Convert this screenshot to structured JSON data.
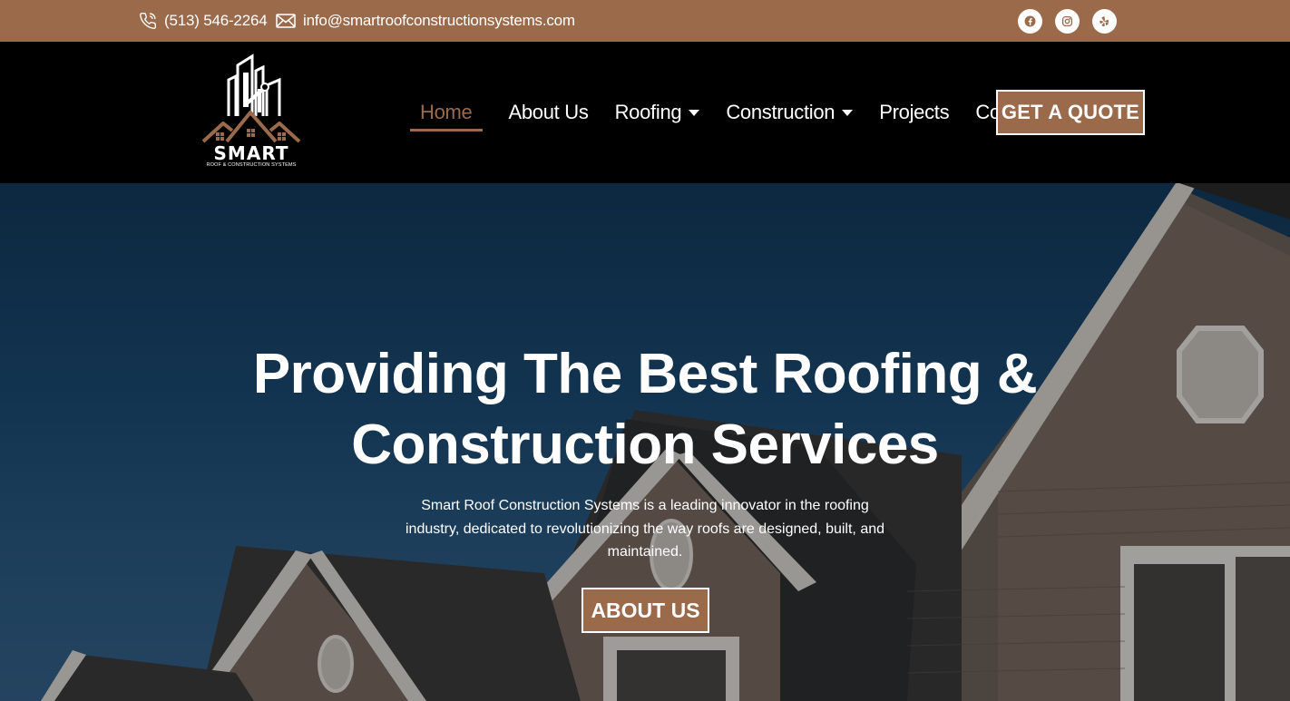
{
  "topbar": {
    "phone": "(513) 546-2264",
    "email": "info@smartroofconstructionsystems.com",
    "socials": [
      {
        "name": "facebook",
        "icon": "facebook-icon"
      },
      {
        "name": "instagram",
        "icon": "instagram-icon"
      },
      {
        "name": "yelp",
        "icon": "yelp-icon"
      }
    ]
  },
  "logo": {
    "brand": "SMART",
    "tagline": "ROOF & CONSTRUCTION SYSTEMS"
  },
  "nav": {
    "items": [
      {
        "label": "Home",
        "active": true,
        "dropdown": false
      },
      {
        "label": "About Us",
        "active": false,
        "dropdown": false
      },
      {
        "label": "Roofing",
        "active": false,
        "dropdown": true
      },
      {
        "label": "Construction",
        "active": false,
        "dropdown": true
      },
      {
        "label": "Projects",
        "active": false,
        "dropdown": false
      },
      {
        "label": "Contact Us",
        "active": false,
        "dropdown": false
      }
    ],
    "cta": "GET A QUOTE"
  },
  "hero": {
    "title_line1": "Providing The Best Roofing &",
    "title_line2": "Construction Services",
    "description": "Smart Roof Construction Systems is a leading innovator in the roofing industry, dedicated to revolutionizing the way roofs are designed, built, and maintained.",
    "button": "ABOUT US"
  },
  "colors": {
    "accent": "#9a6a4b",
    "header_bg": "#000000",
    "text": "#ffffff"
  }
}
